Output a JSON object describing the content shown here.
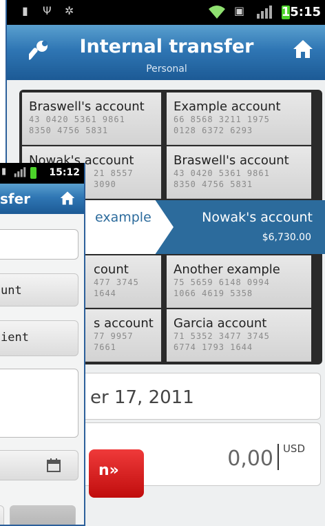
{
  "main": {
    "status": {
      "time": "15:15"
    },
    "header": {
      "title": "Internal transfer",
      "subtitle": "Personal"
    },
    "accounts": [
      {
        "name": "Braswell's account",
        "number_line1": "43 0420 5361 9861",
        "number_line2": "8350 4756 5831"
      },
      {
        "name": "Example account",
        "number_line1": "66 8568 3211 1975",
        "number_line2": "0128 6372 6293"
      },
      {
        "name": "Nowak's account",
        "number_line1": "21 8557",
        "number_line2": "3090"
      },
      {
        "name": "Braswell's account",
        "number_line1": "43 0420 5361 9861",
        "number_line2": "8350 4756 5831"
      },
      {
        "name": "count",
        "number_line1": "477 3745",
        "number_line2": "1644"
      },
      {
        "name": "Another example",
        "number_line1": "75 5659 6148 0994",
        "number_line2": "1066 4619 5358"
      },
      {
        "name": "s account",
        "number_line1": "77 9957",
        "number_line2": "7661"
      },
      {
        "name": "Garcia account",
        "number_line1": "71 5352 3477 3745",
        "number_line2": "6774 1793 1644"
      }
    ],
    "selected_from": {
      "name": "example"
    },
    "selected_to": {
      "name": "Nowak's account",
      "amount": "$6,730.00"
    },
    "date": "er 17, 2011",
    "transfer_button": {
      "label": "n»"
    },
    "amount": {
      "value": "0,00",
      "currency": "USD"
    }
  },
  "overlay": {
    "status": {
      "time": "15:12"
    },
    "header": {
      "title": "sfer"
    },
    "buttons": [
      {
        "label": "unt"
      },
      {
        "label": "ient"
      }
    ]
  },
  "colors": {
    "title_blue": "#2f76b4",
    "selection_blue": "#2c6b9c",
    "transfer_red": "#d81e1e",
    "battery_green": "#4cd42a"
  }
}
